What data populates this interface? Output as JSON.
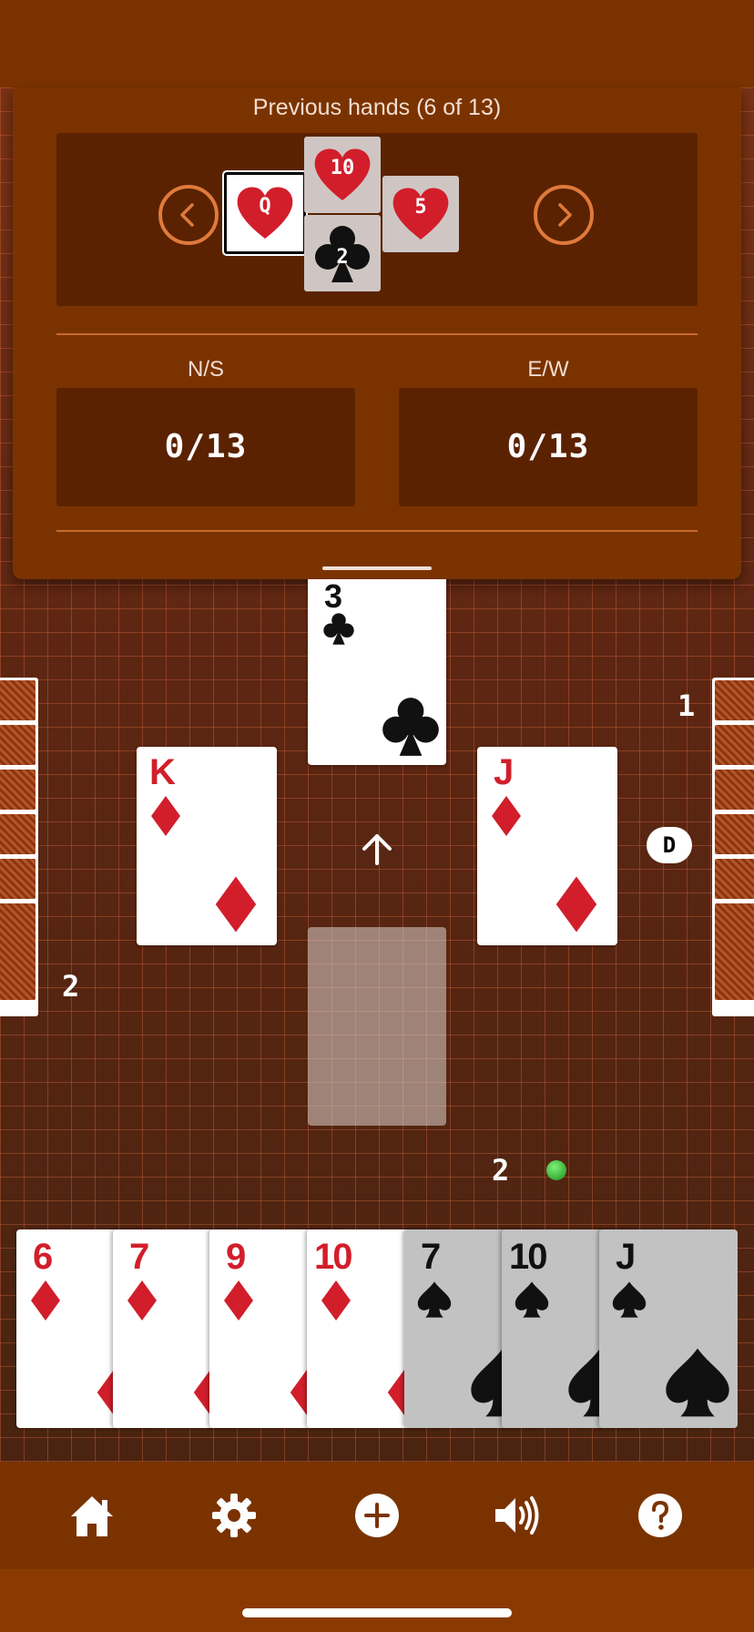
{
  "previous_hands": {
    "title": "Previous hands (6 of 13)",
    "trick": [
      {
        "rank": "Q",
        "suit": "hearts",
        "selected": true
      },
      {
        "rank": "10",
        "suit": "hearts"
      },
      {
        "rank": "5",
        "suit": "hearts"
      },
      {
        "rank": "2",
        "suit": "clubs"
      }
    ]
  },
  "scores": {
    "ns_label": "N/S",
    "ns_value": "0/13",
    "ew_label": "E/W",
    "ew_value": "0/13"
  },
  "table": {
    "north_card": {
      "rank": "3",
      "suit": "clubs"
    },
    "west_card": {
      "rank": "K",
      "suit": "diamonds"
    },
    "east_card": {
      "rank": "J",
      "suit": "diamonds"
    },
    "west_tricks": "2",
    "east_tricks": "1",
    "south_tricks": "2",
    "dealer_badge": "D"
  },
  "hand": [
    {
      "rank": "6",
      "suit": "diamonds",
      "playable": true
    },
    {
      "rank": "7",
      "suit": "diamonds",
      "playable": true
    },
    {
      "rank": "9",
      "suit": "diamonds",
      "playable": true
    },
    {
      "rank": "10",
      "suit": "diamonds",
      "playable": true
    },
    {
      "rank": "7",
      "suit": "spades",
      "playable": false
    },
    {
      "rank": "10",
      "suit": "spades",
      "playable": false
    },
    {
      "rank": "J",
      "suit": "spades",
      "playable": false
    }
  ],
  "nav": [
    "home-icon",
    "settings-icon",
    "add-icon",
    "sound-icon",
    "help-icon"
  ],
  "colors": {
    "accent": "#e07a3c",
    "panel": "#7a3300",
    "red_suit": "#d21e2b"
  }
}
